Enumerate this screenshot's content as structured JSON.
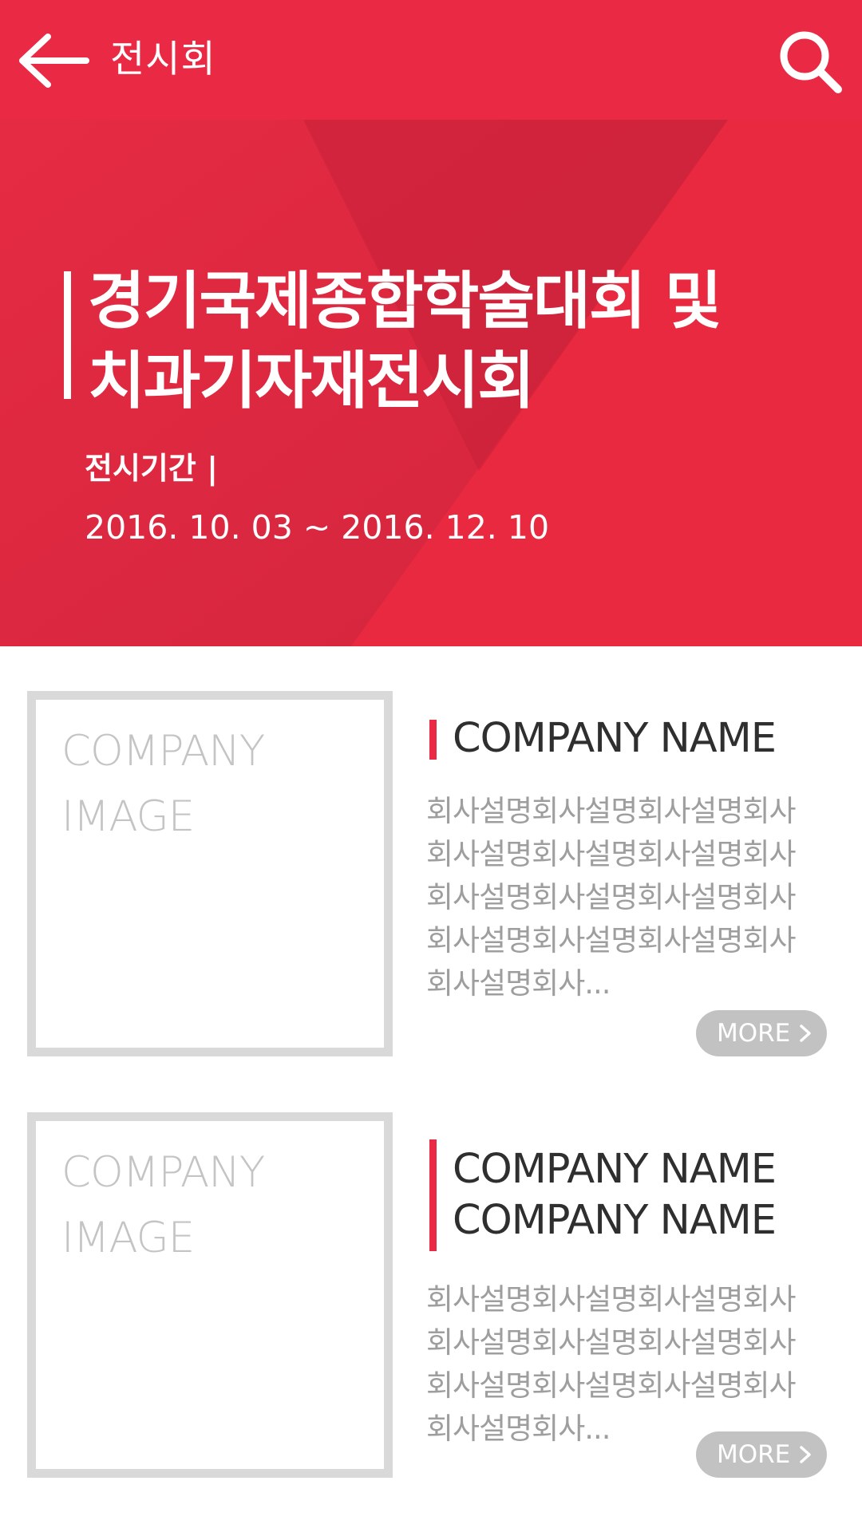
{
  "header": {
    "title": "전시회",
    "back_icon": "back-arrow-icon",
    "search_icon": "search-icon",
    "background_color": "#ea2944"
  },
  "hero": {
    "title_lines": [
      "경기국제종합학술대회 및",
      "치과기자재전시회"
    ],
    "period_label": "전시기간 |",
    "period_value": "2016. 10. 03 ~ 2016. 12. 10",
    "background_color": "#e42a42"
  },
  "companies": [
    {
      "image_placeholder": [
        "COMPANY",
        "IMAGE"
      ],
      "name_lines": [
        "COMPANY NAME"
      ],
      "description_lines": [
        "회사설명회사설명회사설명회사",
        "회사설명회사설명회사설명회사",
        "회사설명회사설명회사설명회사",
        "회사설명회사설명회사설명회사",
        "회사설명회사..."
      ],
      "more_label": "MORE"
    },
    {
      "image_placeholder": [
        "COMPANY",
        "IMAGE"
      ],
      "name_lines": [
        "COMPANY NAME",
        "COMPANY NAME"
      ],
      "description_lines": [
        "회사설명회사설명회사설명회사",
        "회사설명회사설명회사설명회사",
        "회사설명회사설명회사설명회사",
        "회사설명회사..."
      ],
      "more_label": "MORE"
    }
  ],
  "colors": {
    "accent": "#ea2944",
    "placeholder_border": "#d9d9d9",
    "more_button": "#c2c2c2",
    "description_text": "#9e9e9e"
  }
}
